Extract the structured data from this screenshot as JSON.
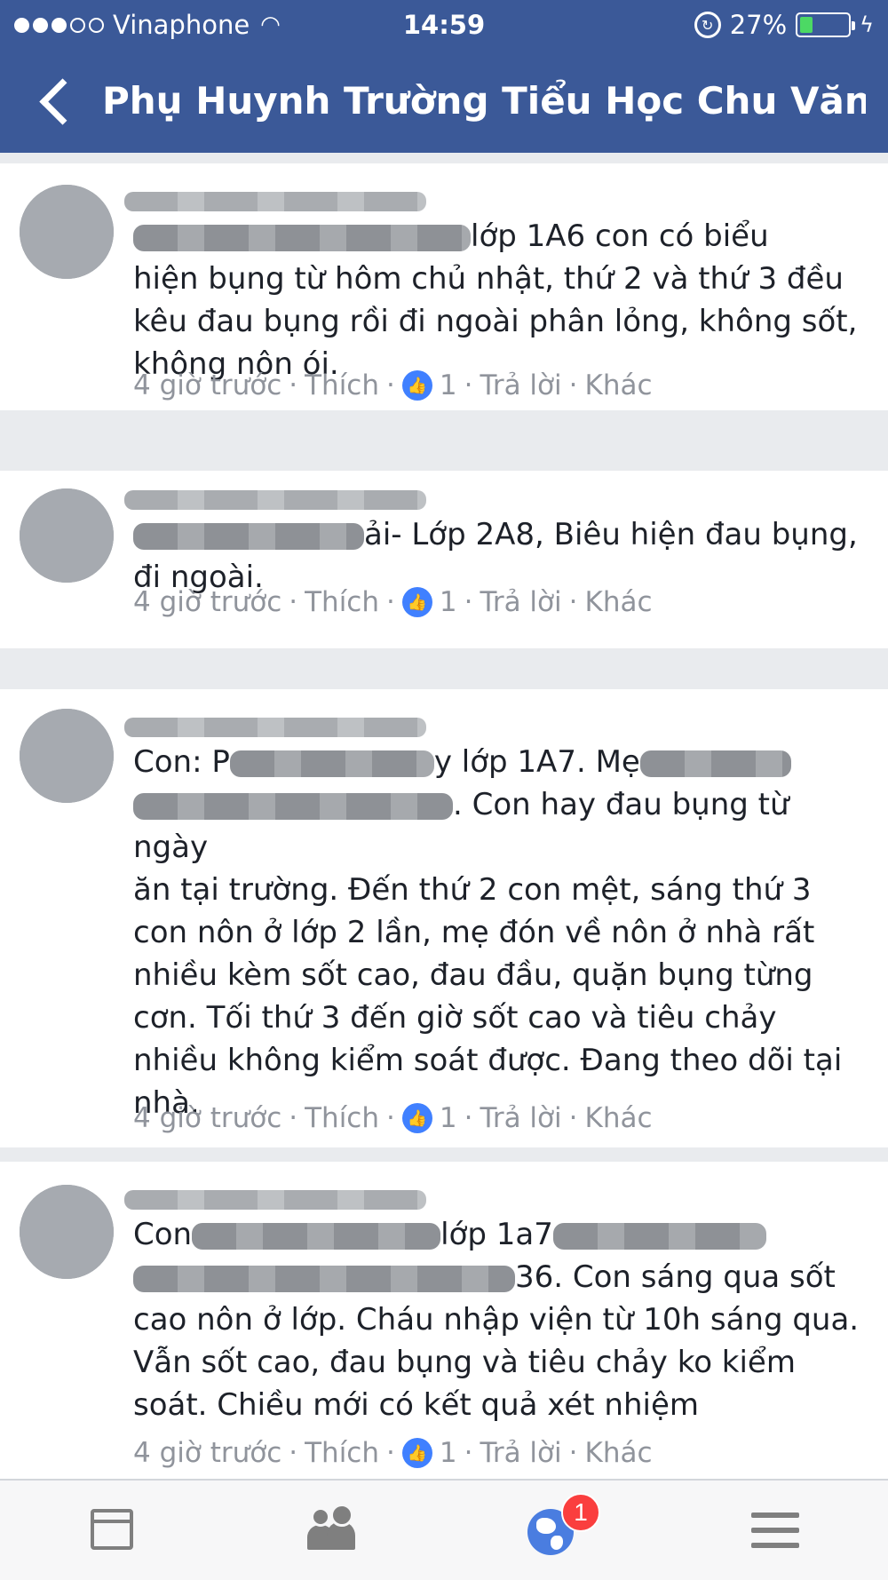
{
  "status_bar": {
    "carrier": "Vinaphone",
    "time": "14:59",
    "battery_percent": "27%",
    "battery_level": 0.27
  },
  "nav": {
    "title": "Phụ Huynh Trường Tiểu Học Chu Văn..."
  },
  "comments": [
    {
      "body_visible": [
        "lớp 1A6 con có biểu",
        "hiện bụng từ hôm chủ nhật, thứ 2 và thứ 3 đều",
        "kêu đau bụng rồi đi ngoài phân lỏng, không sốt,",
        "không nôn ói."
      ],
      "time": "4 giờ trước",
      "like": "Thích",
      "likes": "1",
      "reply": "Trả lời",
      "more": "Khác"
    },
    {
      "body_visible": [
        "ải- Lớp 2A8, Biêu hiện đau bụng,",
        "đi ngoài."
      ],
      "time": "4 giờ trước",
      "like": "Thích",
      "likes": "1",
      "reply": "Trả lời",
      "more": "Khác"
    },
    {
      "body_visible": [
        "Con: P",
        "y lớp 1A7. Mẹ",
        ". Con hay đau bụng từ ngày",
        "ăn tại trường. Đến thứ 2 con mệt, sáng thứ 3",
        "con nôn ở lớp 2 lần, mẹ đón về nôn ở nhà rất",
        "nhiều kèm sốt cao, đau đầu, quặn bụng từng",
        "cơn. Tối thứ 3 đến giờ sốt cao và tiêu chảy",
        "nhiều không kiểm soát được. Đang theo dõi tại",
        "nhà."
      ],
      "time": "4 giờ trước",
      "like": "Thích",
      "likes": "1",
      "reply": "Trả lời",
      "more": "Khác"
    },
    {
      "body_visible": [
        "Con",
        "lớp 1a7",
        "36. Con sáng qua sốt",
        "cao nôn ở lớp. Cháu nhập viện từ 10h sáng qua.",
        "Vẫn sốt cao, đau bụng và tiêu chảy ko kiểm",
        "soát. Chiều mới có kết quả xét nhiệm"
      ],
      "time": "4 giờ trước",
      "like": "Thích",
      "likes": "1",
      "reply": "Trả lời",
      "more": "Khác"
    }
  ],
  "tabbar": {
    "icons": [
      "news-feed-icon",
      "friends-icon",
      "globe-notifications-icon",
      "menu-icon"
    ],
    "notification_count": "1"
  },
  "colors": {
    "brand": "#3b5998",
    "like_blue": "#4080ff",
    "badge_red": "#fa3e3e"
  }
}
